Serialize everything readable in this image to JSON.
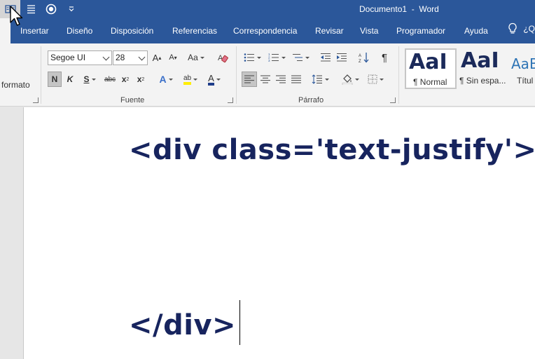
{
  "app": {
    "document_name": "Documento1",
    "separator": "  -  ",
    "app_name": "Word"
  },
  "tabs": [
    {
      "label": "Insertar"
    },
    {
      "label": "Diseño"
    },
    {
      "label": "Disposición"
    },
    {
      "label": "Referencias"
    },
    {
      "label": "Correspondencia"
    },
    {
      "label": "Revisar"
    },
    {
      "label": "Vista"
    },
    {
      "label": "Programador"
    },
    {
      "label": "Ayuda"
    }
  ],
  "tabs_right_text": "¿Q",
  "clipboard": {
    "partial_label": "formato"
  },
  "font": {
    "group_label": "Fuente",
    "font_name": "Segoe UI",
    "font_size": "28",
    "grow": "A",
    "shrink": "A",
    "change_case": "Aa",
    "bold": "N",
    "italic": "K",
    "underline": "S",
    "strike": "abc",
    "subscript": "x",
    "superscript": "x",
    "text_effects": "A",
    "highlight": "ab",
    "font_color": "A"
  },
  "paragraph": {
    "group_label": "Párrafo",
    "show_marks": "¶"
  },
  "styles": [
    {
      "sample": "AaI",
      "name": "¶ Normal"
    },
    {
      "sample": "AaI",
      "name": "¶ Sin espa..."
    },
    {
      "sample": "AaB",
      "name": "Títul"
    }
  ],
  "document": {
    "line1": "<div class='text-justify'>",
    "line2": "</div>"
  },
  "colors": {
    "title_bar": "#2b579a",
    "ribbon": "#f3f3f3",
    "doc_text": "#17245e"
  }
}
